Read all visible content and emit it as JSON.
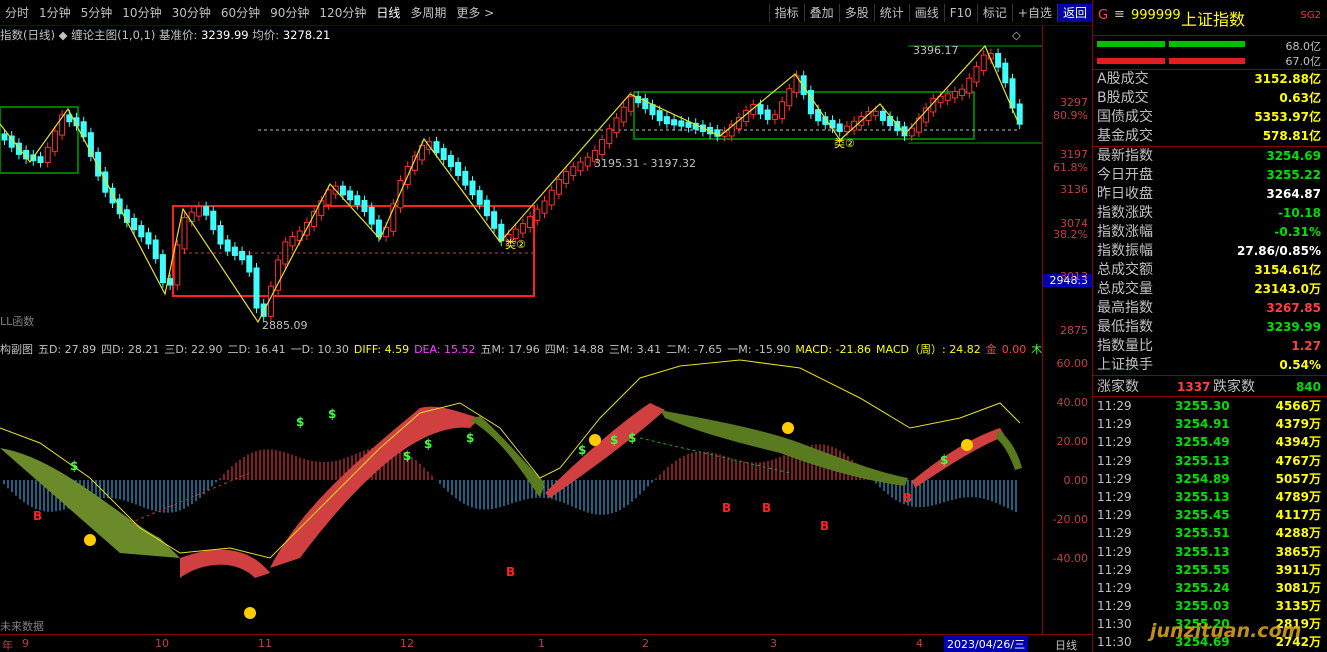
{
  "toolbar": {
    "periods": [
      "分时",
      "1分钟",
      "5分钟",
      "10分钟",
      "30分钟",
      "60分钟",
      "90分钟",
      "120分钟",
      "日线",
      "多周期",
      "更多 >"
    ],
    "tools": [
      "指标",
      "叠加",
      "多股",
      "统计",
      "画线",
      "F10",
      "标记",
      "+自选",
      "返回"
    ]
  },
  "main_header": {
    "name": "指数(日线)",
    "indicator": "◆ 缠论主图(1,0,1)",
    "base_label": "基准价:",
    "base_value": "3239.99",
    "avg_label": "均价:",
    "avg_value": "3278.21",
    "corner_icon": "◇"
  },
  "chart_annotations": {
    "high_label": "3396.17",
    "low_label": "2885.09",
    "range_label": "3195.31 - 3197.32",
    "pivot_mark": "类②",
    "pivot_mark2": "类②",
    "sub_name_label": "LL函数",
    "future_label": "未来数据"
  },
  "price_axis": {
    "ticks": [
      "3297",
      "80.9%",
      "3197",
      "61.8%",
      "3136",
      "3074",
      "38.2%",
      "3013",
      "2875"
    ],
    "current_badge": "2948.3"
  },
  "sub_header": {
    "items": [
      {
        "text": "构副图",
        "color": "#c0c0c0"
      },
      {
        "text": "五D: 27.89",
        "color": "#c0c0c0"
      },
      {
        "text": "四D: 28.21",
        "color": "#c0c0c0"
      },
      {
        "text": "三D: 22.90",
        "color": "#c0c0c0"
      },
      {
        "text": "二D: 16.41",
        "color": "#c0c0c0"
      },
      {
        "text": "一D: 10.30",
        "color": "#c0c0c0"
      },
      {
        "text": "DIFF: 4.59",
        "color": "#ffff00"
      },
      {
        "text": "DEA: 15.52",
        "color": "#ff40ff"
      },
      {
        "text": "五M: 17.96",
        "color": "#c0c0c0"
      },
      {
        "text": "四M: 14.88",
        "color": "#c0c0c0"
      },
      {
        "text": "三M: 3.41",
        "color": "#c0c0c0"
      },
      {
        "text": "二M: -7.65",
        "color": "#c0c0c0"
      },
      {
        "text": "一M: -15.90",
        "color": "#c0c0c0"
      },
      {
        "text": "MACD: -21.86",
        "color": "#ffff00"
      },
      {
        "text": "MACD（周）: 24.82",
        "color": "#ffff00"
      },
      {
        "text": "金",
        "color": "#ff4040"
      },
      {
        "text": "0.00",
        "color": "#ff4040"
      },
      {
        "text": "木",
        "color": "#40ff40"
      }
    ]
  },
  "sub_axis": {
    "ticks": [
      "60.00",
      "40.00",
      "20.00",
      "0.00",
      "-20.00",
      "-40.00"
    ]
  },
  "date_axis": {
    "labels": [
      "年",
      "9",
      "10",
      "11",
      "12",
      "1",
      "2",
      "3",
      "4"
    ],
    "cursor_date": "2023/04/26/三",
    "period": "日线"
  },
  "quote_panel": {
    "g": "G",
    "menu_icon": "≡",
    "code": "999999",
    "name": "上证指数",
    "sg": "SG2",
    "bar_values": [
      "68.0亿",
      "67.0亿"
    ],
    "rows": [
      {
        "k": "A股成交",
        "v": "3152.88亿",
        "c": "#ffff00"
      },
      {
        "k": "B股成交",
        "v": "0.63亿",
        "c": "#ffff00"
      },
      {
        "k": "国债成交",
        "v": "5353.97亿",
        "c": "#ffff00"
      },
      {
        "k": "基金成交",
        "v": "578.81亿",
        "c": "#ffff00"
      }
    ],
    "rows2": [
      {
        "k": "最新指数",
        "v": "3254.69",
        "c": "#00e000"
      },
      {
        "k": "今日开盘",
        "v": "3255.22",
        "c": "#00e000"
      },
      {
        "k": "昨日收盘",
        "v": "3264.87",
        "c": "#ffffff"
      },
      {
        "k": "指数涨跌",
        "v": "-10.18",
        "c": "#00e000"
      },
      {
        "k": "指数涨幅",
        "v": "-0.31%",
        "c": "#00e000"
      },
      {
        "k": "指数振幅",
        "v": "27.86/0.85%",
        "c": "#ffffff"
      },
      {
        "k": "总成交额",
        "v": "3154.61亿",
        "c": "#ffff00"
      },
      {
        "k": "总成交量",
        "v": "23143.0万",
        "c": "#ffff00"
      },
      {
        "k": "最高指数",
        "v": "3267.85",
        "c": "#ff4040"
      },
      {
        "k": "最低指数",
        "v": "3239.99",
        "c": "#00e000"
      },
      {
        "k": "指数量比",
        "v": "1.27",
        "c": "#ff4040"
      },
      {
        "k": "上证换手",
        "v": "0.54%",
        "c": "#ffff00"
      }
    ],
    "up_label": "涨家数",
    "up_value": "1337",
    "down_label": "跌家数",
    "down_value": "840",
    "ticks": [
      {
        "t": "11:29",
        "p": "3255.30",
        "v": "4566万"
      },
      {
        "t": "11:29",
        "p": "3254.91",
        "v": "4379万"
      },
      {
        "t": "11:29",
        "p": "3255.49",
        "v": "4394万"
      },
      {
        "t": "11:29",
        "p": "3255.13",
        "v": "4767万"
      },
      {
        "t": "11:29",
        "p": "3254.89",
        "v": "5057万"
      },
      {
        "t": "11:29",
        "p": "3255.13",
        "v": "4789万"
      },
      {
        "t": "11:29",
        "p": "3255.45",
        "v": "4117万"
      },
      {
        "t": "11:29",
        "p": "3255.51",
        "v": "4288万"
      },
      {
        "t": "11:29",
        "p": "3255.13",
        "v": "3865万"
      },
      {
        "t": "11:29",
        "p": "3255.55",
        "v": "3911万"
      },
      {
        "t": "11:29",
        "p": "3255.24",
        "v": "3081万"
      },
      {
        "t": "11:29",
        "p": "3255.03",
        "v": "3135万"
      },
      {
        "t": "11:30",
        "p": "3255.20",
        "v": "2819万"
      },
      {
        "t": "11:30",
        "p": "3254.69",
        "v": "2742万"
      }
    ]
  },
  "watermark": "junzituan.com"
}
